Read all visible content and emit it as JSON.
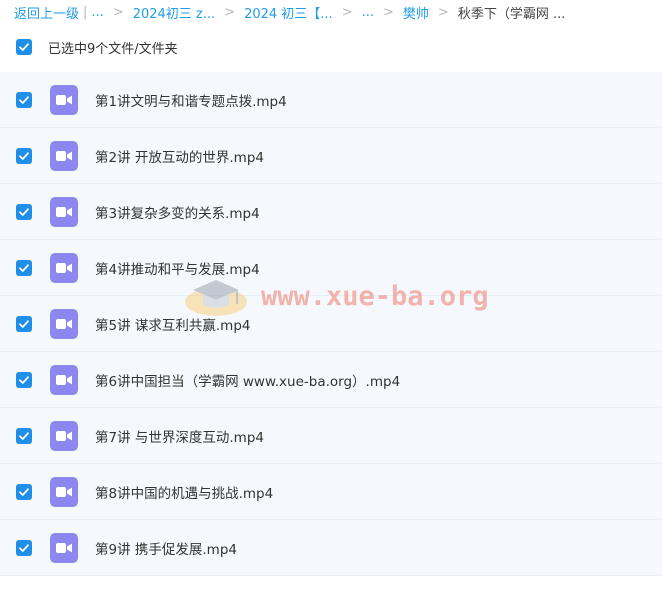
{
  "breadcrumb": {
    "back_label": "返回上一级",
    "items": [
      "...",
      "2024初三 z...",
      "2024 初三【...",
      "...",
      "樊帅"
    ],
    "current": "秋季下（学霸网 ..."
  },
  "select_all": {
    "label": "已选中9个文件/文件夹"
  },
  "files": [
    {
      "name": "第1讲文明与和谐专题点拨.mp4"
    },
    {
      "name": "第2讲 开放互动的世界.mp4"
    },
    {
      "name": "第3讲复杂多变的关系.mp4"
    },
    {
      "name": "第4讲推动和平与发展.mp4"
    },
    {
      "name": "第5讲 谋求互利共赢.mp4"
    },
    {
      "name": "第6讲中国担当（学霸网 www.xue-ba.org）.mp4"
    },
    {
      "name": "第7讲 与世界深度互动.mp4"
    },
    {
      "name": "第8讲中国的机遇与挑战.mp4"
    },
    {
      "name": "第9讲 携手促发展.mp4"
    }
  ],
  "watermark": {
    "text": "www.xue-ba.org"
  },
  "colors": {
    "link": "#1f9de8",
    "checkbox": "#1f8ee8",
    "video_icon": "#8b87ef",
    "row_bg": "#f5f8fd",
    "watermark": "#f07b6b"
  },
  "icons": {
    "check": "check-icon",
    "file": "video-file-icon",
    "watermark": "graduation-cap-logo"
  }
}
